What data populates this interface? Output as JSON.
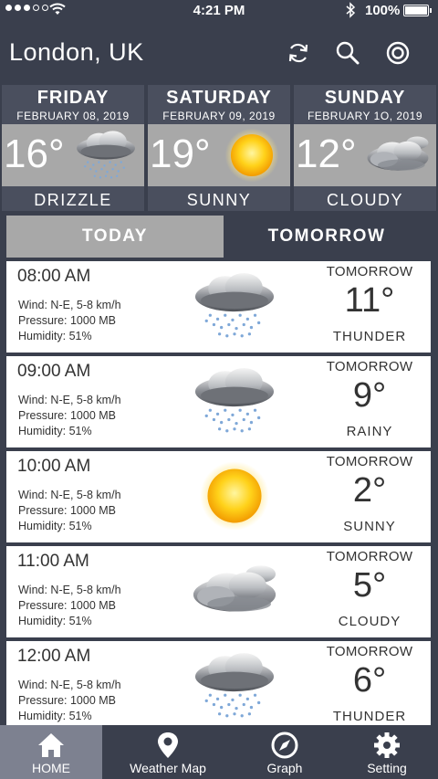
{
  "status_bar": {
    "time": "4:21 PM",
    "battery": "100%"
  },
  "header": {
    "city": "London, UK",
    "icons": [
      "refresh-icon",
      "search-icon",
      "location-target-icon"
    ]
  },
  "days": [
    {
      "name": "FRIDAY",
      "date": "FEBRUARY 08, 2019",
      "temp": "16°",
      "condition": "DRIZZLE",
      "icon": "drizzle-icon"
    },
    {
      "name": "SATURDAY",
      "date": "FEBRUARY 09, 2019",
      "temp": "19°",
      "condition": "SUNNY",
      "icon": "sun-icon"
    },
    {
      "name": "SUNDAY",
      "date": "FEBRUARY 1O, 2019",
      "temp": "12°",
      "condition": "CLOUDY",
      "icon": "cloudy-icon"
    }
  ],
  "tabs": {
    "today": "TODAY",
    "tomorrow": "TOMORROW",
    "active": "today"
  },
  "hours": [
    {
      "time": "08:00 AM",
      "wind": "Wind: N-E, 5-8 km/h",
      "pressure": "Pressure: 1000 MB",
      "humidity": "Humidity: 51%",
      "day": "TOMORROW",
      "temp": "11°",
      "condition": "THUNDER",
      "icon": "thunder-icon"
    },
    {
      "time": "09:00 AM",
      "wind": "Wind: N-E, 5-8 km/h",
      "pressure": "Pressure: 1000 MB",
      "humidity": "Humidity: 51%",
      "day": "TOMORROW",
      "temp": "9°",
      "condition": "RAINY",
      "icon": "rain-icon"
    },
    {
      "time": "10:00 AM",
      "wind": "Wind: N-E, 5-8 km/h",
      "pressure": "Pressure: 1000 MB",
      "humidity": "Humidity: 51%",
      "day": "TOMORROW",
      "temp": "2°",
      "condition": "SUNNY",
      "icon": "sun-icon"
    },
    {
      "time": "11:00 AM",
      "wind": "Wind: N-E, 5-8 km/h",
      "pressure": "Pressure: 1000 MB",
      "humidity": "Humidity: 51%",
      "day": "TOMORROW",
      "temp": "5°",
      "condition": "CLOUDY",
      "icon": "cloudy-icon"
    },
    {
      "time": "12:00 AM",
      "wind": "Wind: N-E, 5-8 km/h",
      "pressure": "Pressure: 1000 MB",
      "humidity": "Humidity: 51%",
      "day": "TOMORROW",
      "temp": "6°",
      "condition": "THUNDER",
      "icon": "thunder-icon"
    }
  ],
  "nav": [
    {
      "label": "HOME",
      "icon": "home-icon"
    },
    {
      "label": "Weather Map",
      "icon": "map-pin-icon"
    },
    {
      "label": "Graph",
      "icon": "compass-icon"
    },
    {
      "label": "Setting",
      "icon": "gear-icon"
    }
  ],
  "colors": {
    "background": "#3a3f4d",
    "card": "#4a4f5e",
    "panel_gray": "#a8a8a8",
    "active_nav": "#7d8190",
    "sun": "#ffc61a"
  }
}
